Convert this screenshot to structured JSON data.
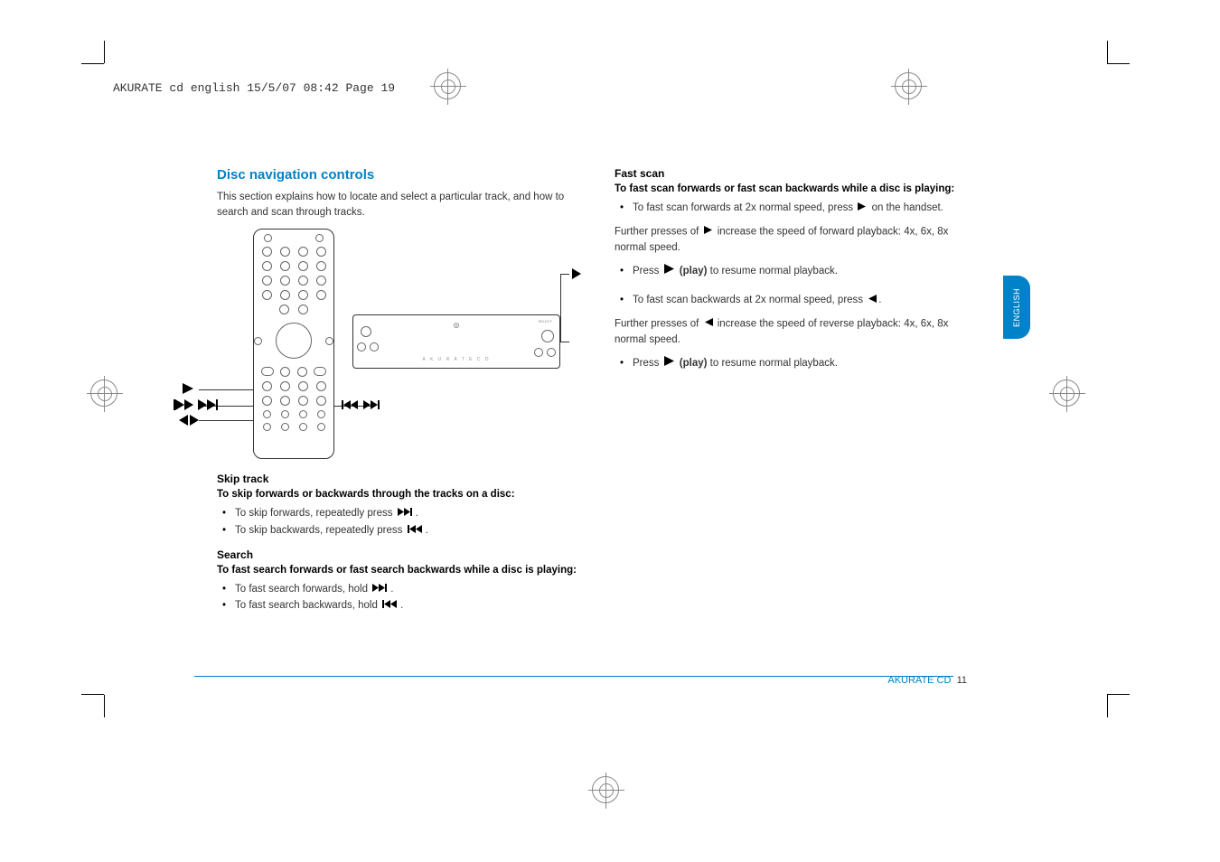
{
  "header": "AKURATE cd english  15/5/07  08:42  Page 19",
  "main_heading": "Disc navigation controls",
  "intro": "This section explains how to locate and select a particular track, and how to search and scan through tracks.",
  "skip": {
    "heading": "Skip track",
    "bold": "To skip forwards or backwards through the tracks on a disc:",
    "items": [
      "To skip forwards, repeatedly press ",
      "To skip backwards, repeatedly press "
    ]
  },
  "search": {
    "heading": "Search",
    "bold": "To fast search forwards or fast search backwards while a disc is playing:",
    "items": [
      "To fast search forwards, hold ",
      "To fast search backwards, hold "
    ]
  },
  "fast": {
    "heading": "Fast scan",
    "bold": "To fast scan forwards or fast scan backwards while a disc is playing:",
    "item1_a": "To fast scan forwards at 2x normal speed, press ",
    "item1_b": " on the handset.",
    "para1_a": "Further presses of ",
    "para1_b": " increase the speed of forward playback: 4x, 6x, 8x normal speed.",
    "item2_a": "Press ",
    "play_label": " (play)",
    "item2_b": " to resume normal playback.",
    "item3_a": "To fast scan backwards at 2x normal speed, press ",
    "item3_b": ".",
    "para2_a": "Further presses of ",
    "para2_b": " increase the speed of reverse playback: 4x, 6x, 8x normal speed.",
    "item4_a": "Press ",
    "item4_b": " to resume normal playback."
  },
  "deck_label": "A K U R A T E   C D",
  "footer": {
    "brand": "AKURATE CD",
    "page": "11"
  },
  "lang_tab": "ENGLISH",
  "icons": {
    "fwd": "skip-forward-icon",
    "back": "skip-back-icon",
    "play": "play-icon",
    "rev": "reverse-icon",
    "leftright": "left-right-icon"
  }
}
